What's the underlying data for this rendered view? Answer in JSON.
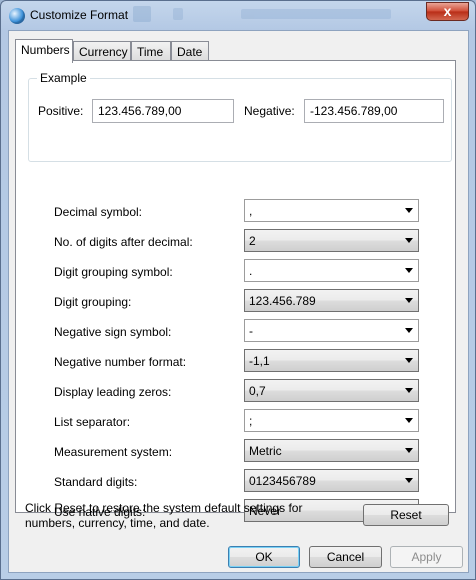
{
  "window": {
    "title": "Customize Format",
    "close_label": "x"
  },
  "tabs": [
    {
      "label": "Numbers",
      "active": true
    },
    {
      "label": "Currency",
      "active": false
    },
    {
      "label": "Time",
      "active": false
    },
    {
      "label": "Date",
      "active": false
    }
  ],
  "example": {
    "legend": "Example",
    "positive_label": "Positive:",
    "positive_value": "123.456.789,00",
    "negative_label": "Negative:",
    "negative_value": "-123.456.789,00"
  },
  "settings": [
    {
      "label": "Decimal symbol:",
      "value": ","
    },
    {
      "label": "No. of digits after decimal:",
      "value": "2"
    },
    {
      "label": "Digit grouping symbol:",
      "value": "."
    },
    {
      "label": "Digit grouping:",
      "value": "123.456.789"
    },
    {
      "label": "Negative sign symbol:",
      "value": "-"
    },
    {
      "label": "Negative number format:",
      "value": "-1,1"
    },
    {
      "label": "Display leading zeros:",
      "value": "0,7"
    },
    {
      "label": "List separator:",
      "value": ";"
    },
    {
      "label": "Measurement system:",
      "value": "Metric"
    },
    {
      "label": "Standard digits:",
      "value": "0123456789"
    },
    {
      "label": "Use native digits:",
      "value": "Never"
    }
  ],
  "reset": {
    "text": "Click Reset to restore the system default settings for numbers, currency, time, and date.",
    "button_label": "Reset"
  },
  "footer": {
    "ok_label": "OK",
    "cancel_label": "Cancel",
    "apply_label": "Apply"
  }
}
